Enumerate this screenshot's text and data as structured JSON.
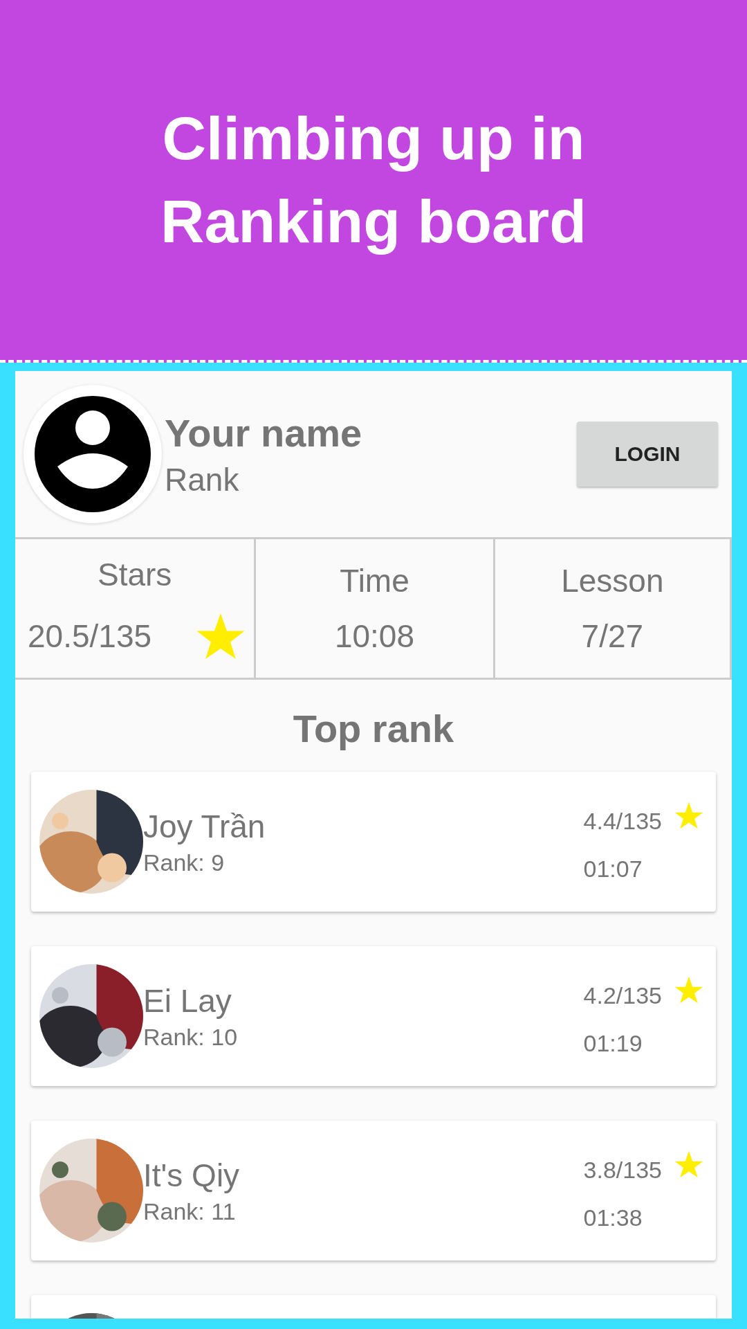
{
  "banner": {
    "title": "Climbing up in Ranking board"
  },
  "profile": {
    "name": "Your name",
    "rank": "Rank",
    "login_button": "LOGIN"
  },
  "stats": [
    {
      "label": "Stars",
      "value": "20.5/135",
      "kind": "stars"
    },
    {
      "label": "Time",
      "value": "10:08",
      "kind": "plain"
    },
    {
      "label": "Lesson",
      "value": "7/27",
      "kind": "plain"
    }
  ],
  "top_rank": {
    "title": "Top rank",
    "entries": [
      {
        "kind": "full",
        "name": "Joy Trần",
        "rank": "Rank: 9",
        "score": "4.4/135",
        "time": "01:07"
      },
      {
        "kind": "full",
        "name": "Ei Lay",
        "rank": "Rank: 10",
        "score": "4.2/135",
        "time": "01:19"
      },
      {
        "kind": "full",
        "name": "It's Qiy",
        "rank": "Rank: 11",
        "score": "3.8/135",
        "time": "01:38"
      },
      {
        "kind": "partial"
      }
    ]
  }
}
